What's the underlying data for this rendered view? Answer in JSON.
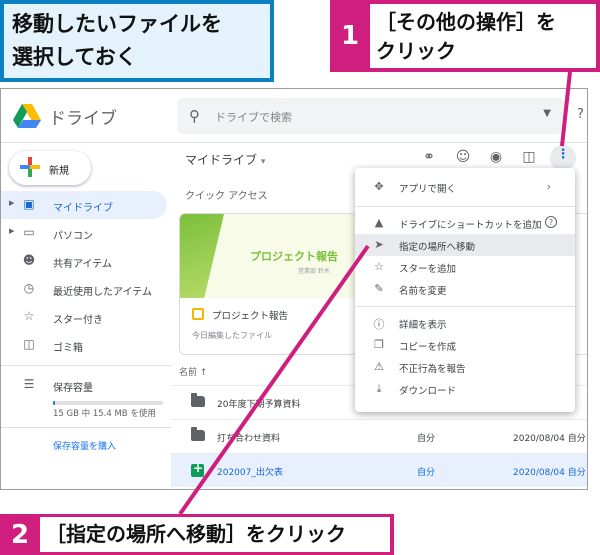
{
  "callouts": {
    "intro_line1": "移動したいファイルを",
    "intro_line2": "選択しておく",
    "step1_number": "1",
    "step1_line1": "［その他の操作］を",
    "step1_line2": "クリック",
    "step2_number": "2",
    "step2_text": "［指定の場所へ移動］をクリック",
    "accent_color": "#d01e7e"
  },
  "header": {
    "app_title": "ドライブ",
    "search_placeholder": "ドライブで検索",
    "search_icon": "search-icon",
    "help_icon": "help-icon"
  },
  "sidebar": {
    "new_label": "新規",
    "items": [
      {
        "label": "マイドライブ",
        "icon": "drive-icon",
        "active": true
      },
      {
        "label": "パソコン",
        "icon": "computer-icon"
      },
      {
        "label": "共有アイテム",
        "icon": "people-icon"
      },
      {
        "label": "最近使用したアイテム",
        "icon": "clock-icon"
      },
      {
        "label": "スター付き",
        "icon": "star-icon"
      },
      {
        "label": "ゴミ箱",
        "icon": "trash-icon"
      }
    ],
    "storage_label": "保存容量",
    "storage_used_fraction": 0.014,
    "storage_text": "15 GB 中 15.4 MB を使用",
    "buy_storage": "保存容量を購入"
  },
  "main": {
    "breadcrumb": "マイドライブ",
    "quick_access": "クイック アクセス",
    "card": {
      "thumb_title": "プロジェクト報告",
      "thumb_sub": "営業部 鈴木",
      "name": "プロジェクト報告",
      "meta": "今日編集したファイル"
    },
    "column_name": "名前 ↑",
    "rows": [
      {
        "name": "20年度下期予算資料",
        "owner": "",
        "date": "",
        "type": "folder"
      },
      {
        "name": "打ち合わせ資料",
        "owner": "自分",
        "date": "2020/08/04 自分",
        "type": "folder"
      },
      {
        "name": "202007_出欠表",
        "owner": "自分",
        "date": "2020/08/04 自分",
        "type": "sheet",
        "selected": true
      }
    ]
  },
  "menu": {
    "items": [
      {
        "label": "アプリで開く",
        "icon": "move-arrows-icon",
        "has_submenu": true
      },
      {
        "label": "ドライブにショートカットを追加",
        "icon": "drive-shortcut-icon",
        "has_help": true
      },
      {
        "label": "指定の場所へ移動",
        "icon": "move-to-folder-icon",
        "highlight": true
      },
      {
        "label": "スターを追加",
        "icon": "star-icon"
      },
      {
        "label": "名前を変更",
        "icon": "pencil-icon"
      },
      {
        "label": "詳細を表示",
        "icon": "info-icon"
      },
      {
        "label": "コピーを作成",
        "icon": "copy-icon"
      },
      {
        "label": "不正行為を報告",
        "icon": "report-icon"
      },
      {
        "label": "ダウンロード",
        "icon": "download-icon"
      }
    ]
  }
}
